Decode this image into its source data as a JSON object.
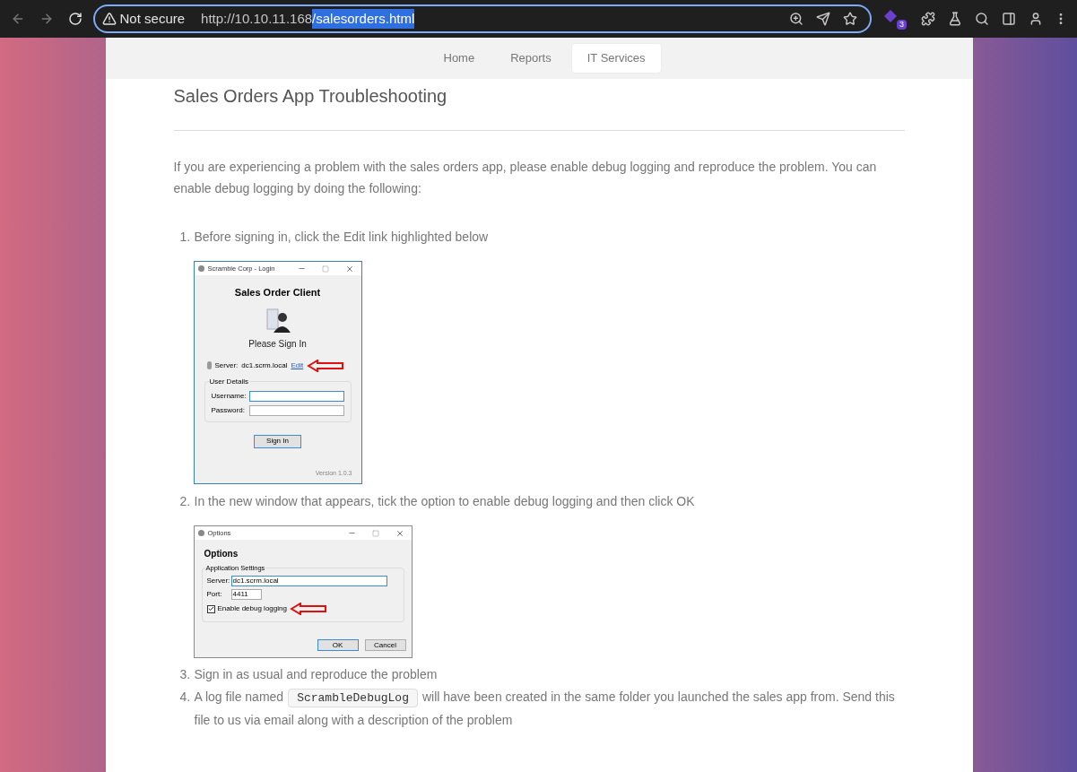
{
  "browser": {
    "security": "Not secure",
    "url_host": "http://10.10.11.168",
    "url_path": "/salesorders.html",
    "url_path_selected": true,
    "extension_badge": "3"
  },
  "nav": [
    {
      "label": "Home",
      "selected": false
    },
    {
      "label": "Reports",
      "selected": false
    },
    {
      "label": "IT Services",
      "selected": true
    }
  ],
  "title": "Sales Orders App Troubleshooting",
  "intro": "If you are experiencing a problem with the sales orders app, please enable debug logging and reproduce the problem. You can enable debug logging by doing the following:",
  "steps": [
    {
      "number": "1.",
      "text": "Before signing in, click the Edit link highlighted below"
    },
    {
      "number": "2.",
      "text": "In the new window that appears, tick the option to enable debug logging and then click OK"
    },
    {
      "number": "3.",
      "text": "Sign in as usual and reproduce the problem"
    },
    {
      "number": "4.",
      "text": "A log file named",
      "code": "ScrambleDebugLog",
      "text_after": "will have been created in the same folder you launched the sales app from. Send this file to us via email along with a description of the problem"
    }
  ],
  "login_window": {
    "title": "Scramble Corp - Login",
    "heading": "Sales Order Client",
    "prompt": "Please Sign In",
    "server_label": "Server:",
    "server_value": "dc1.scrm.local",
    "edit_link": "Edit",
    "group": "User Details",
    "fields": [
      {
        "label": "Username:"
      },
      {
        "label": "Password:"
      }
    ],
    "button": "Sign In",
    "version": "Version 1.0.3"
  },
  "options_window": {
    "title": "Options",
    "heading": "Options",
    "group": "Application Settings",
    "fields": [
      {
        "label": "Server:",
        "value": "dc1.scrm.local"
      },
      {
        "label": "Port:",
        "value": "4411"
      }
    ],
    "checkbox": {
      "label": "Enable debug logging",
      "checked": true
    },
    "buttons": [
      {
        "label": "OK",
        "default": true
      },
      {
        "label": "Cancel",
        "default": false
      }
    ]
  }
}
